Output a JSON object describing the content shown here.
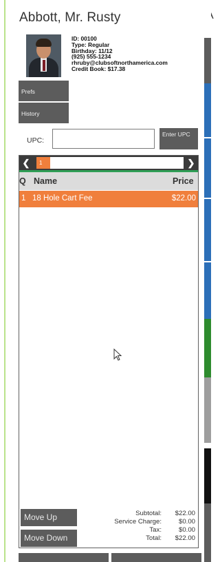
{
  "customer": {
    "name": "Abbott, Mr. Rusty",
    "details": [
      "ID: 00100",
      "Type: Regular",
      "Birthday: 11/12",
      "(925) 555-1234",
      "rhruby@clubsoftnorthamerica.com",
      "Credit Book: $17.38"
    ]
  },
  "next_panel_header": "A",
  "buttons": {
    "prefs": "Prefs",
    "history": "History",
    "enter_upc": "Enter UPC",
    "move_up": "Move Up",
    "move_down": "Move Down"
  },
  "upc": {
    "label": "UPC:",
    "value": "",
    "placeholder": ""
  },
  "pager": {
    "current_page": "1"
  },
  "list": {
    "columns": {
      "q": "Q",
      "name": "Name",
      "price": "Price"
    },
    "items": [
      {
        "q": "1",
        "name": "18 Hole Cart Fee",
        "price": "$22.00"
      }
    ]
  },
  "totals": {
    "subtotal_label": "Subtotal:",
    "subtotal": "$22.00",
    "service_label": "Service Charge:",
    "service": "$0.00",
    "tax_label": "Tax:",
    "tax": "$0.00",
    "total_label": "Total:",
    "total": "$22.00"
  },
  "colors": {
    "accent_orange": "#f07f3c",
    "button_gray": "#5c5c5c",
    "pager_dark": "#3a3a3a",
    "green_line": "#2f9e55",
    "strip_blue": "#2c6fb8",
    "strip_green": "#2e8b2e",
    "strip_gray": "#9e9e9e",
    "strip_black": "#111111"
  }
}
